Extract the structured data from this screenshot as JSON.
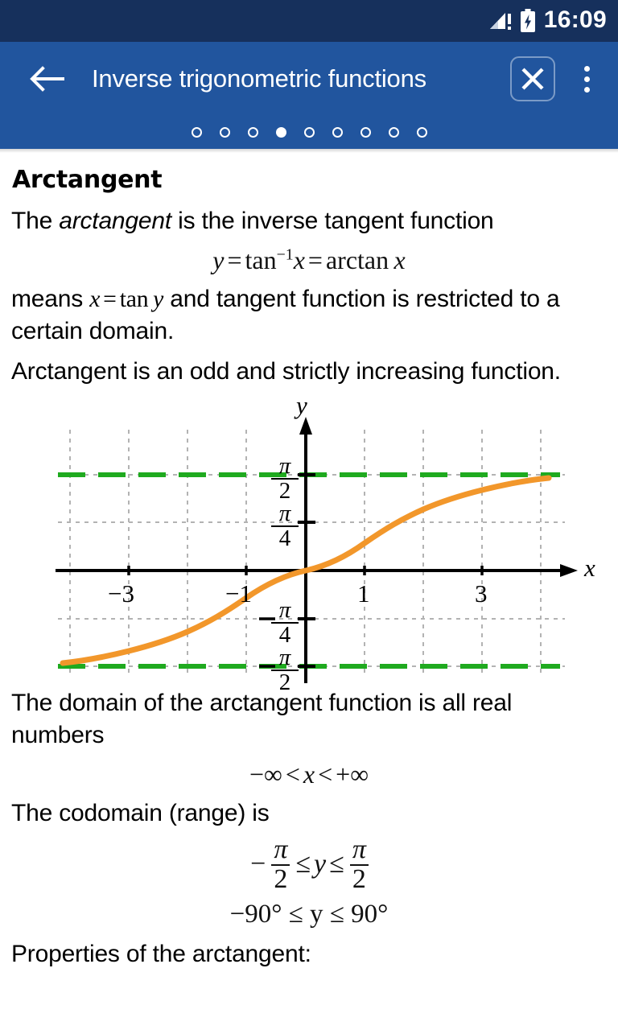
{
  "status_bar": {
    "time": "16:09",
    "signal_icon": "signal-no-sim-icon",
    "battery_icon": "battery-charging-icon",
    "background": "#16305c"
  },
  "app_bar": {
    "background": "#21559e",
    "back_icon": "back-arrow-icon",
    "title": "Inverse trigonometric functions",
    "close_icon": "close-icon",
    "overflow_icon": "overflow-menu-icon",
    "pager": {
      "total": 9,
      "active_index": 3
    }
  },
  "content": {
    "heading": "Arctangent",
    "p1_before": "The ",
    "p1_italic": "arctangent",
    "p1_after": " is the inverse tangent function",
    "formula1": {
      "y": "y",
      "eq1": "=",
      "tan": "tan",
      "exp": "−1",
      "x1": "x",
      "eq2": "=",
      "arctan": "arctan",
      "x2": "x"
    },
    "p2_before": "means ",
    "p2_math_x": "x",
    "p2_math_eq": "=",
    "p2_math_tan": "tan",
    "p2_math_y": "y",
    "p2_after": " and tangent function is restricted to a certain domain.",
    "p3": "Arctangent is an odd and strictly increasing function.",
    "p4": "The domain of the arctangent function is all real numbers",
    "formula2": "−∞ < x < +∞",
    "formula2_parts": {
      "lhs": "−∞",
      "lt1": "<",
      "var": "x",
      "lt2": "<",
      "rhs": "+∞"
    },
    "p5": "The codomain (range) is",
    "formula3": {
      "minus": "−",
      "num1": "π",
      "den1": "2",
      "le1": "≤",
      "var": "y",
      "le2": "≤",
      "num2": "π",
      "den2": "2"
    },
    "formula4": "−90° ≤ y ≤ 90°",
    "p6": "Properties of the arctangent:"
  },
  "chart_data": {
    "type": "line",
    "title": "",
    "xlabel": "x",
    "ylabel": "y",
    "grid": true,
    "xlim": [
      -4.3,
      4.3
    ],
    "ylim": [
      -1.77,
      1.77
    ],
    "x_ticks": [
      -4,
      -3,
      -2,
      -1,
      1,
      2,
      3,
      4
    ],
    "x_tick_labels": [
      "",
      "−3",
      "",
      "−1",
      "1",
      "",
      "3",
      ""
    ],
    "y_ticks": [
      -1.5708,
      -0.7854,
      0.7854,
      1.5708
    ],
    "y_tick_labels": [
      "-pi/2",
      "-pi/4",
      "pi/4",
      "pi/2"
    ],
    "y_tick_fracs": [
      {
        "sign": "−",
        "num": "π",
        "den": "2",
        "value": -1.5708
      },
      {
        "sign": "−",
        "num": "π",
        "den": "4",
        "value": -0.7854
      },
      {
        "sign": "",
        "num": "π",
        "den": "4",
        "value": 0.7854
      },
      {
        "sign": "",
        "num": "π",
        "den": "2",
        "value": 1.5708
      }
    ],
    "series": [
      {
        "name": "arctan(x)",
        "color": "#f2972b",
        "style": "solid",
        "x": [
          -4.2,
          -4.0,
          -3.6,
          -3.2,
          -2.8,
          -2.4,
          -2.0,
          -1.6,
          -1.2,
          -0.8,
          -0.4,
          0,
          0.4,
          0.8,
          1.2,
          1.6,
          2.0,
          2.4,
          2.8,
          3.2,
          3.6,
          4.0,
          4.2
        ],
        "y": [
          -1.337,
          -1.326,
          -1.301,
          -1.268,
          -1.228,
          -1.176,
          -1.107,
          -1.012,
          -0.876,
          -0.675,
          -0.381,
          0,
          0.381,
          0.675,
          0.876,
          1.012,
          1.107,
          1.176,
          1.228,
          1.268,
          1.301,
          1.326,
          1.337
        ]
      },
      {
        "name": "asymptote y = pi/2",
        "color": "#1faa1f",
        "style": "dashdot",
        "y_const": 1.5708
      },
      {
        "name": "asymptote y = -pi/2",
        "color": "#1faa1f",
        "style": "dashdot",
        "y_const": -1.5708
      }
    ],
    "grid_color": "#b0b0b0",
    "axis_color": "#000000"
  }
}
